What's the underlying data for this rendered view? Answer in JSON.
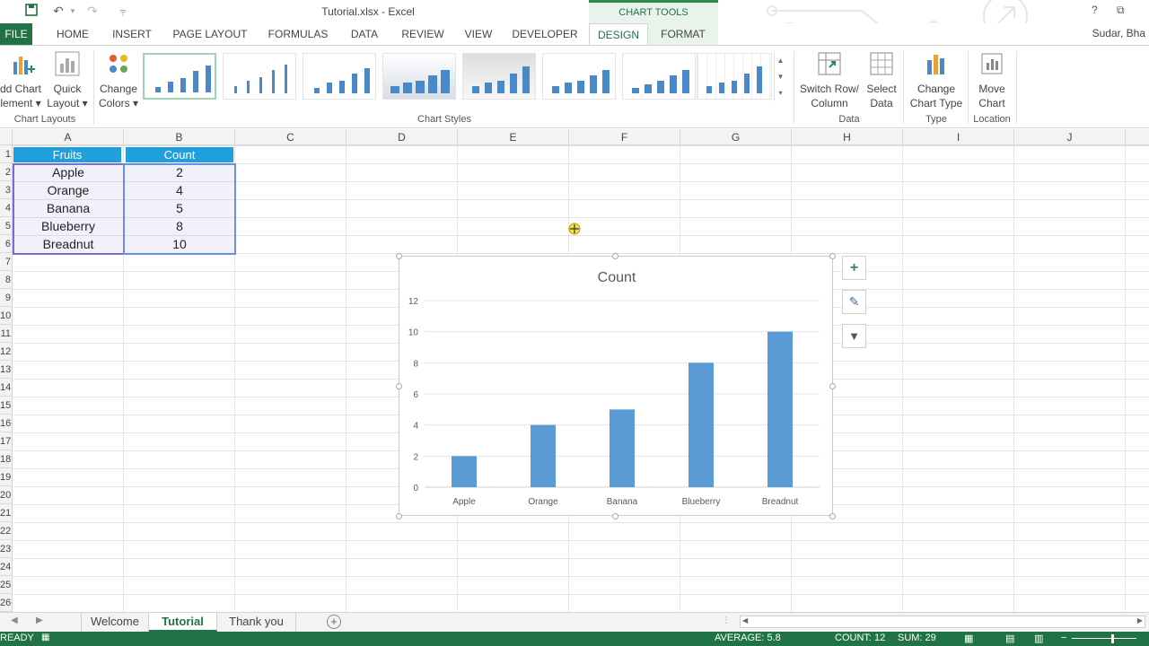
{
  "window": {
    "title": "Tutorial.xlsx - Excel",
    "chart_tools": "CHART TOOLS",
    "help": "?",
    "restore": "⧉",
    "user": "Sudar, Bha"
  },
  "tabs": [
    "FILE",
    "HOME",
    "INSERT",
    "PAGE LAYOUT",
    "FORMULAS",
    "DATA",
    "REVIEW",
    "VIEW",
    "DEVELOPER",
    "DESIGN",
    "FORMAT"
  ],
  "ribbon": {
    "add_chart": [
      "dd Chart",
      "lement ▾"
    ],
    "quick_layout": [
      "Quick",
      "Layout ▾"
    ],
    "chart_layouts": "Chart Layouts",
    "change_colors": [
      "Change",
      "Colors ▾"
    ],
    "chart_styles": "Chart Styles",
    "switch": [
      "Switch Row/",
      "Column"
    ],
    "select_data": [
      "Select",
      "Data"
    ],
    "data_group": "Data",
    "change_type": [
      "Change",
      "Chart Type"
    ],
    "type_group": "Type",
    "move_chart": [
      "Move",
      "Chart"
    ],
    "location_group": "Location"
  },
  "columns": [
    "A",
    "B",
    "C",
    "D",
    "E",
    "F",
    "G",
    "H",
    "I",
    "J"
  ],
  "rows": [
    "1",
    "2",
    "3",
    "4",
    "5",
    "6",
    "7",
    "8",
    "9",
    "10",
    "11",
    "12",
    "13",
    "14",
    "15",
    "16",
    "17",
    "18",
    "19",
    "20",
    "21",
    "22",
    "23",
    "24",
    "25",
    "26"
  ],
  "table": {
    "headers": [
      "Fruits",
      "Count"
    ],
    "rows": [
      {
        "fruit": "Apple",
        "count": "2"
      },
      {
        "fruit": "Orange",
        "count": "4"
      },
      {
        "fruit": "Banana",
        "count": "5"
      },
      {
        "fruit": "Blueberry",
        "count": "8"
      },
      {
        "fruit": "Breadnut",
        "count": "10"
      }
    ]
  },
  "chart_data": {
    "type": "bar",
    "title": "Count",
    "categories": [
      "Apple",
      "Orange",
      "Banana",
      "Blueberry",
      "Breadnut"
    ],
    "values": [
      2,
      4,
      5,
      8,
      10
    ],
    "ylim": [
      0,
      12
    ],
    "yticks": [
      0,
      2,
      4,
      6,
      8,
      10,
      12
    ],
    "grid": true,
    "bar_color": "#5b9bd5"
  },
  "chart_side_buttons": {
    "elements": "+",
    "styles": "✎",
    "filter": "▼"
  },
  "sheets": [
    "Welcome",
    "Tutorial",
    "Thank you"
  ],
  "status": {
    "mode": "READY",
    "average": "AVERAGE: 5.8",
    "count": "COUNT: 12",
    "sum": "SUM: 29"
  },
  "colors": {
    "excel_green": "#217346",
    "header_fill": "#1f9fdb",
    "selection": "#7d6bd0"
  }
}
